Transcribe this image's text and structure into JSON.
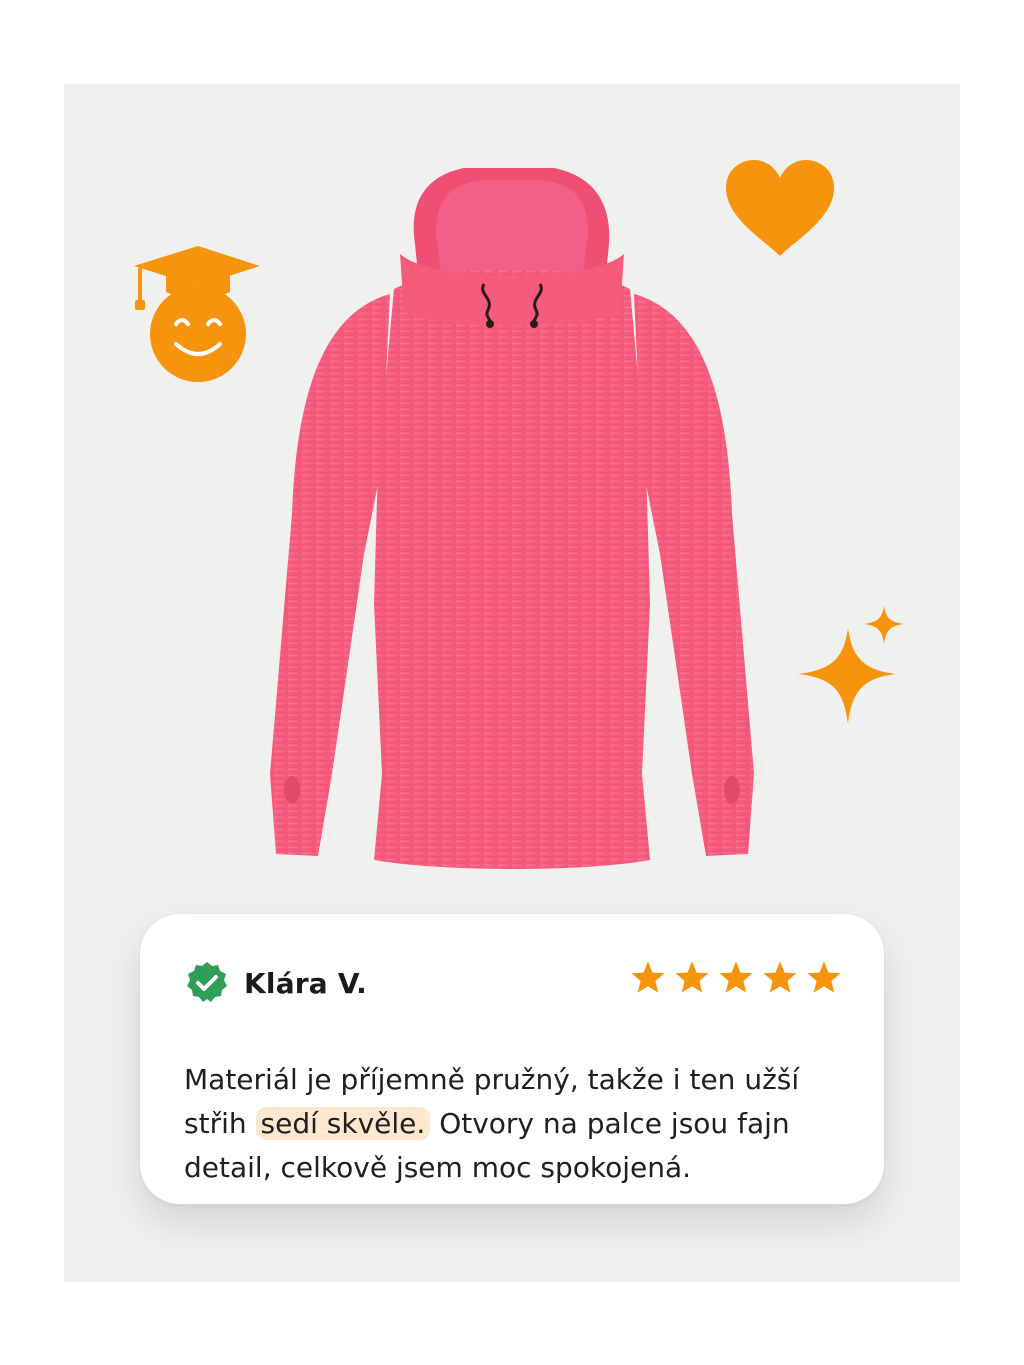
{
  "review": {
    "reviewer_name": "Klára V.",
    "rating": 5,
    "rating_max": 5,
    "text_before": "Materiál je příjemně pružný, takže i ten užší střih ",
    "text_highlight": "sedí skvěle.",
    "text_after": " Otvory na palce jsou fajn detail, celkově jsem moc spokojená."
  },
  "icons": {
    "badge": "verified-check-badge-icon",
    "star": "star-icon",
    "heart": "heart-icon",
    "sparkles": "sparkles-icon",
    "graduate": "smiley-graduation-cap-icon"
  },
  "colors": {
    "accent": "#f7940d",
    "verified": "#2e9e58",
    "highlight": "#fde7cf",
    "product": "#f75d7c",
    "background": "#f0f0ef"
  }
}
